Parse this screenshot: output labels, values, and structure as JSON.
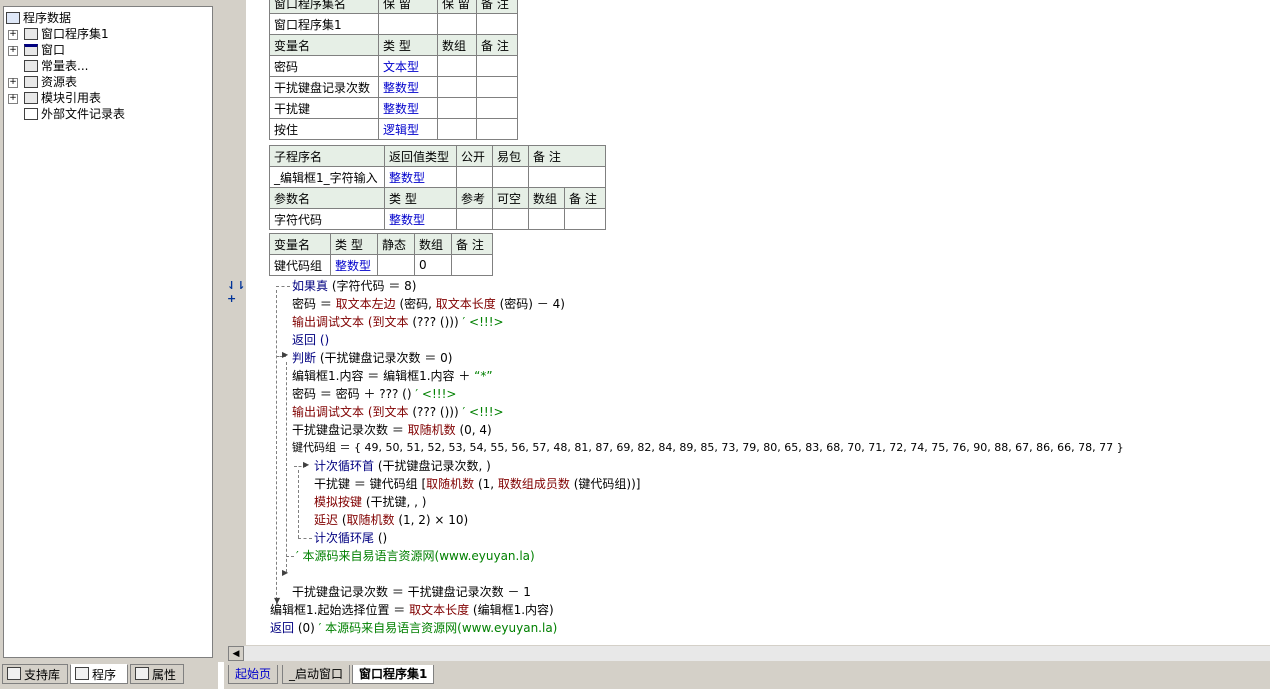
{
  "tree": {
    "root": "程序数据",
    "items": [
      {
        "label": "窗口程序集1",
        "icon": "assembly-icon"
      },
      {
        "label": "窗口",
        "icon": "window-icon"
      },
      {
        "label": "常量表...",
        "icon": "constant-icon"
      },
      {
        "label": "资源表",
        "icon": "resource-icon"
      },
      {
        "label": "模块引用表",
        "icon": "module-icon"
      },
      {
        "label": "外部文件记录表",
        "icon": "file-icon"
      }
    ]
  },
  "bottom_tabs": [
    "支持库",
    "程序",
    "属性"
  ],
  "assembly_table": {
    "header": [
      "窗口程序集名",
      "保 留",
      "保 留",
      "备 注"
    ],
    "row": [
      "窗口程序集1",
      "",
      "",
      ""
    ],
    "var_header": [
      "变量名",
      "类 型",
      "数组",
      "备 注"
    ],
    "vars": [
      [
        "密码",
        "文本型"
      ],
      [
        "干扰键盘记录次数",
        "整数型"
      ],
      [
        "干扰键",
        "整数型"
      ],
      [
        "按住",
        "逻辑型"
      ]
    ]
  },
  "sub_table": {
    "header": [
      "子程序名",
      "返回值类型",
      "公开",
      "易包",
      "备 注"
    ],
    "row": [
      "_编辑框1_字符输入",
      "整数型"
    ],
    "param_header": [
      "参数名",
      "类 型",
      "参考",
      "可空",
      "数组",
      "备 注"
    ],
    "param": [
      "字符代码",
      "整数型"
    ]
  },
  "local_table": {
    "header": [
      "变量名",
      "类 型",
      "静态",
      "数组",
      "备 注"
    ],
    "row": [
      "键代码组",
      "整数型",
      "",
      "0",
      ""
    ]
  },
  "code": {
    "l1_cmd": "如果真",
    "l1_arg": " (字符代码 ＝ 8)",
    "l2_a": "密码 ＝ ",
    "l2_cmd": "取文本左边",
    "l2_b": " (密码, ",
    "l2_cmd2": "取文本长度",
    "l2_c": " (密码) － 4)",
    "l3_cmd": "输出调试文本",
    "l3_cmd2": " (到文本",
    "l3_b": " (??? ()))",
    "l3_cmt": "  ′ <!!!>",
    "l4": "返回 ()",
    "l5_cmd": "判断",
    "l5_arg": " (干扰键盘记录次数 ＝ 0)",
    "l6_a": "编辑框1.内容 ＝ 编辑框1.内容 ＋ ",
    "l6_str": "“*”",
    "l7_a": "密码 ＝ 密码 ＋ ??? ()",
    "l7_cmt": "  ′ <!!!>",
    "l8_cmd": "输出调试文本",
    "l8_cmd2": " (到文本",
    "l8_b": " (??? ()))",
    "l8_cmt": "  ′ <!!!>",
    "l9_a": "干扰键盘记录次数 ＝ ",
    "l9_cmd": "取随机数",
    "l9_b": " (0, 4)",
    "l10": "键代码组 ＝ { 49, 50, 51, 52, 53, 54, 55, 56, 57, 48, 81, 87, 69, 82, 84, 89, 85, 73, 79, 80, 65, 83, 68, 70, 71, 72, 74, 75, 76, 90, 88, 67, 86, 66, 78, 77 }",
    "l11_kw": "计次循环首",
    "l11_arg": " (干扰键盘记录次数, )",
    "l12_a": "干扰键 ＝ 键代码组 [",
    "l12_cmd": "取随机数",
    "l12_b": " (1, ",
    "l12_cmd2": "取数组成员数",
    "l12_c": " (键代码组))]",
    "l13_cmd": "模拟按键",
    "l13_arg": " (干扰键, , )",
    "l14_cmd": "延迟",
    "l14_b": " (",
    "l14_cmd2": "取随机数",
    "l14_c": " (1, 2) × 10)",
    "l15_kw": "计次循环尾",
    "l15_arg": " ()",
    "l16_cmt": "′ 本源码来自易语言资源网(www.eyuyan.la)",
    "l17_a": "干扰键盘记录次数 ＝ 干扰键盘记录次数 － 1",
    "l18_a": "编辑框1.起始选择位置 ＝ ",
    "l18_cmd": "取文本长度",
    "l18_b": " (编辑框1.内容)",
    "l19_kw": "返回",
    "l19_arg": " (0)",
    "l19_cmt": "  ′ 本源码来自易语言资源网(www.eyuyan.la)"
  },
  "file_tabs": [
    "起始页",
    "_启动窗口",
    "窗口程序集1"
  ],
  "colors": {
    "keyword": "#000080",
    "command": "#800000",
    "comment": "#008000",
    "type": "#0000cc",
    "table_header": "#e6efe6"
  }
}
